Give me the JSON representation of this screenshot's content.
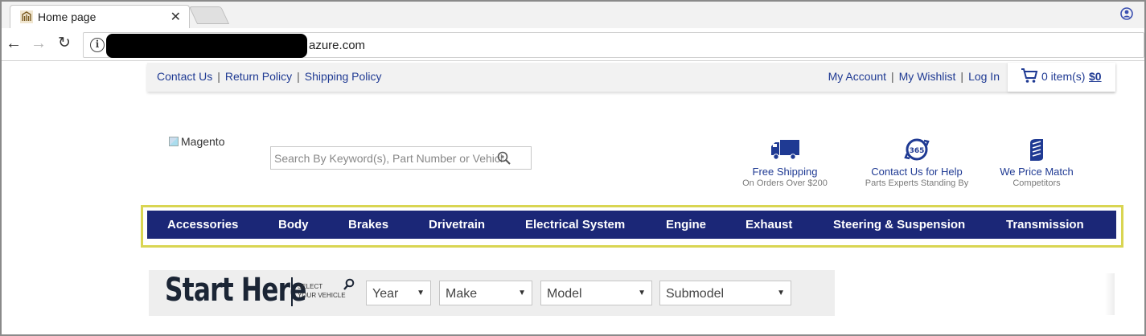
{
  "browser": {
    "tab_title": "Home page",
    "tab_close": "✕",
    "url_visible": "azure.com"
  },
  "topbar": {
    "left_links": [
      "Contact Us",
      "Return Policy",
      "Shipping Policy"
    ],
    "right_links": [
      "My Account",
      "My Wishlist",
      "Log In"
    ],
    "cart_count": "0 item(s)",
    "cart_total": "$0"
  },
  "logo": {
    "alt": "Magento"
  },
  "search": {
    "placeholder": "Search By Keyword(s), Part Number or Vehicle"
  },
  "features": [
    {
      "icon": "truck-icon",
      "title": "Free Shipping",
      "subtitle": "On Orders Over $200"
    },
    {
      "icon": "support-365-icon",
      "title": "Contact Us for Help",
      "subtitle": "Parts Experts Standing By"
    },
    {
      "icon": "price-tag-icon",
      "title": "We Price Match",
      "subtitle": "Competitors"
    }
  ],
  "nav": {
    "items": [
      "Accessories",
      "Body",
      "Brakes",
      "Drivetrain",
      "Electrical System",
      "Engine",
      "Exhaust",
      "Steering & Suspension",
      "Transmission"
    ]
  },
  "selector": {
    "heading": "Start Here",
    "label_line1": "SELECT",
    "label_line2": "YOUR VEHICLE",
    "year": "Year",
    "make": "Make",
    "model": "Model",
    "submodel": "Submodel"
  },
  "colors": {
    "nav_bg": "#1b2777",
    "link": "#1f3a93",
    "highlight": "#d9d552"
  }
}
